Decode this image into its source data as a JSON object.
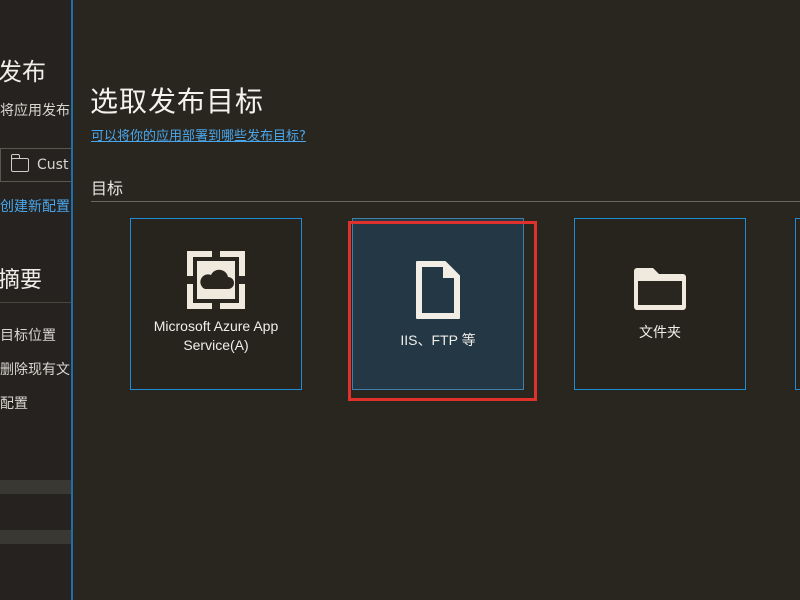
{
  "side_panel": {
    "title": "发布",
    "subtitle": "将应用发布到",
    "profile_select_value": "Cust",
    "new_profile_link": "创建新配置",
    "summary_title": "摘要",
    "summary_items": [
      "目标位置",
      "删除现有文",
      "配置"
    ]
  },
  "main": {
    "title": "选取发布目标",
    "help_link": "可以将你的应用部署到哪些发布目标?",
    "section_label": "目标",
    "targets": [
      {
        "label": "Microsoft Azure App Service(A)",
        "icon": "azure-cloud-icon",
        "selected": false
      },
      {
        "label": "IIS、FTP 等",
        "icon": "document-icon",
        "selected": true
      },
      {
        "label": "文件夹",
        "icon": "folder-icon",
        "selected": false
      }
    ]
  },
  "colors": {
    "background": "#29261f",
    "accent_blue": "#1f8ad6",
    "link_blue": "#4aa6ec",
    "selected_bg": "#233745",
    "highlight_red": "#e0322c"
  }
}
